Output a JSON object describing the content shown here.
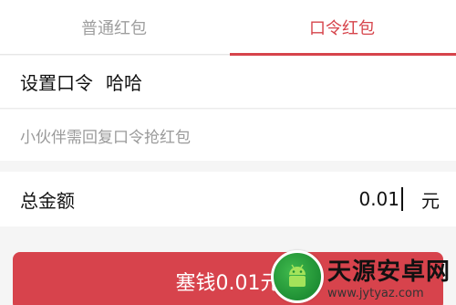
{
  "tabs": [
    {
      "label": "普通红包",
      "active": false
    },
    {
      "label": "口令红包",
      "active": true
    }
  ],
  "password_row": {
    "label": "设置口令",
    "value": "哈哈"
  },
  "hint": "小伙伴需回复口令抢红包",
  "amount_row": {
    "label": "总金额",
    "value": "0.01",
    "unit": "元"
  },
  "submit": {
    "label": "塞钱0.01元"
  },
  "watermark": {
    "title": "天源安卓网",
    "url": "www.jytyaz.com"
  },
  "colors": {
    "accent": "#d6444b",
    "button": "#d7434c",
    "inactive": "#9e9e9e"
  },
  "icons": {
    "watermark_logo": "android-robot-icon"
  }
}
